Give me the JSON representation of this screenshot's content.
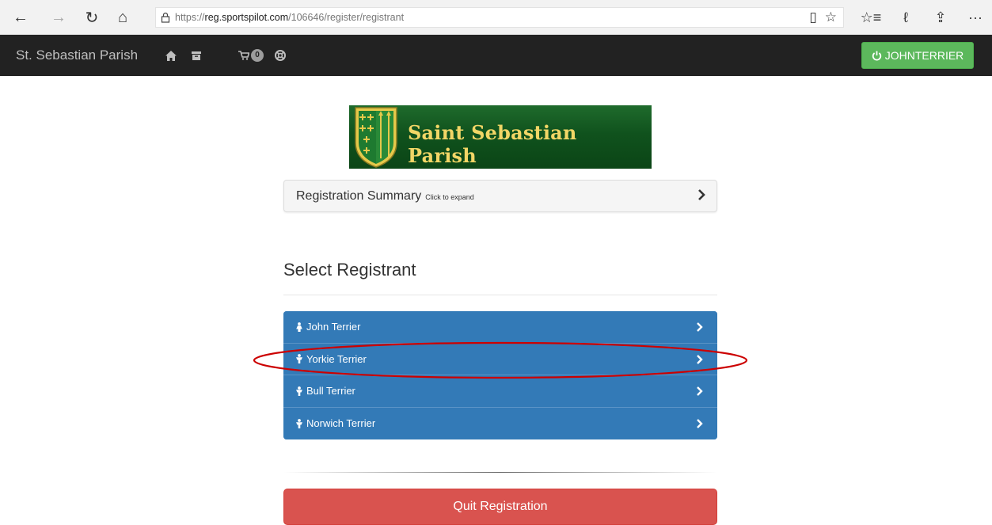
{
  "browser": {
    "back_icon": "←",
    "forward_icon": "→",
    "refresh_icon": "↻",
    "home_icon": "⌂",
    "lock_icon": "lock-icon",
    "url_prefix": "https://",
    "url_host": "reg.sportspilot.com",
    "url_path": "/106646/register/registrant",
    "reading_view_icon": "▯",
    "favorite_icon": "☆",
    "favorites_hub_icon": "☆≡",
    "notes_icon": "ℓ",
    "share_icon": "⇪",
    "more_icon": "···"
  },
  "navbar": {
    "brand": "St. Sebastian Parish",
    "cart_count": "0",
    "user_button": "JOHNTERRIER"
  },
  "logo": {
    "text": "Saint Sebastian Parish"
  },
  "summary": {
    "title": "Registration Summary",
    "hint": "Click to expand"
  },
  "section_title": "Select Registrant",
  "registrants": [
    {
      "name": "John Terrier",
      "icon": "female-icon"
    },
    {
      "name": "Yorkie Terrier",
      "icon": "male-icon"
    },
    {
      "name": "Bull Terrier",
      "icon": "male-icon"
    },
    {
      "name": "Norwich Terrier",
      "icon": "male-icon"
    }
  ],
  "quit_button": "Quit Registration",
  "colors": {
    "navbar": "#222222",
    "success": "#5cb85c",
    "primary": "#337ab7",
    "danger": "#d9534f",
    "annotation": "#cc0000",
    "logo_green": "#145a23",
    "logo_gold": "#f2d666"
  }
}
